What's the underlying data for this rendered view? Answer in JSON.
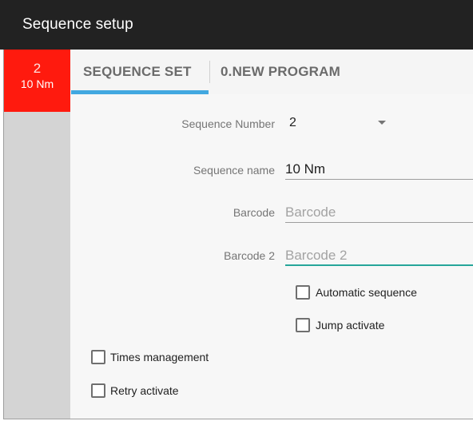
{
  "titlebar": {
    "title": "Sequence setup"
  },
  "sequence_tile": {
    "number": "2",
    "torque": "10 Nm",
    "color": "#ff1a0e"
  },
  "tabs": [
    {
      "label": "SEQUENCE SET",
      "active": true
    },
    {
      "label": "0.NEW PROGRAM",
      "active": false
    }
  ],
  "form": {
    "sequence_number": {
      "label": "Sequence Number",
      "value": "2"
    },
    "sequence_name": {
      "label": "Sequence name",
      "value": "10 Nm"
    },
    "barcode": {
      "label": "Barcode",
      "placeholder": "Barcode",
      "value": ""
    },
    "barcode2": {
      "label": "Barcode 2",
      "placeholder": "Barcode 2",
      "value": ""
    }
  },
  "checkboxes": {
    "automatic_sequence": {
      "label": "Automatic sequence",
      "checked": false
    },
    "jump_activate": {
      "label": "Jump activate",
      "checked": false
    },
    "times_management": {
      "label": "Times management",
      "checked": false
    },
    "retry_activate": {
      "label": "Retry activate",
      "checked": false
    }
  },
  "colors": {
    "titlebar": "#222222",
    "tab_indicator": "#42a8e0",
    "focus_underline": "#26a69a",
    "rail": "#d4d4d4"
  }
}
